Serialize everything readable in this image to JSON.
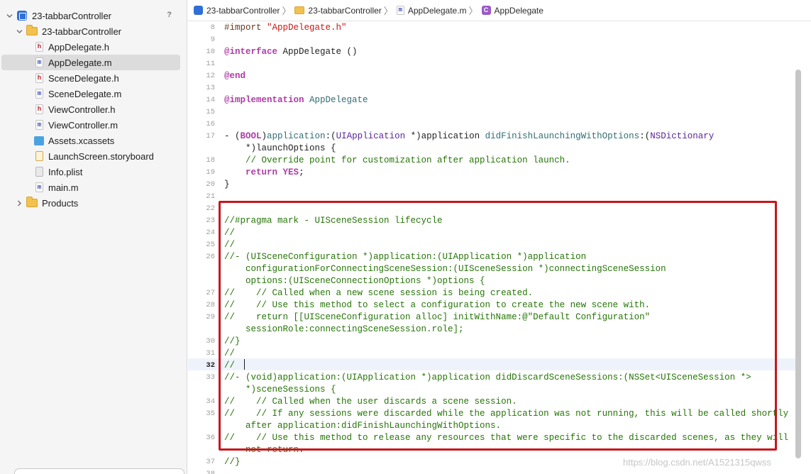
{
  "navigator": {
    "project_name": "23-tabbarController",
    "scm_badge": "?",
    "group_name": "23-tabbarController",
    "files": [
      {
        "name": "AppDelegate.h",
        "kind": "h"
      },
      {
        "name": "AppDelegate.m",
        "kind": "m",
        "selected": true
      },
      {
        "name": "SceneDelegate.h",
        "kind": "h"
      },
      {
        "name": "SceneDelegate.m",
        "kind": "m"
      },
      {
        "name": "ViewController.h",
        "kind": "h"
      },
      {
        "name": "ViewController.m",
        "kind": "m"
      },
      {
        "name": "Assets.xcassets",
        "kind": "assets"
      },
      {
        "name": "LaunchScreen.storyboard",
        "kind": "storyboard"
      },
      {
        "name": "Info.plist",
        "kind": "plist"
      },
      {
        "name": "main.m",
        "kind": "m"
      }
    ],
    "products_label": "Products"
  },
  "jumpbar": {
    "project": "23-tabbarController",
    "group": "23-tabbarController",
    "file": "AppDelegate.m",
    "symbol": "AppDelegate"
  },
  "editor": {
    "current_line": "32",
    "line_numbers": [
      "8",
      "9",
      "10",
      "11",
      "12",
      "13",
      "14",
      "15",
      "16",
      "17",
      "18",
      "19",
      "20",
      "21",
      "22",
      "23",
      "24",
      "25",
      "26",
      "27",
      "28",
      "29",
      "30",
      "31",
      "32",
      "33",
      "34",
      "35",
      "36",
      "37",
      "38"
    ],
    "code": {
      "l8a": "#import ",
      "l8b": "\"AppDelegate.h\"",
      "l10a": "@interface",
      "l10b": " AppDelegate ()",
      "l12": "@end",
      "l14a": "@implementation",
      "l14b": " AppDelegate",
      "l17a": "- (",
      "l17b": "BOOL",
      "l17c": ")",
      "l17d": "application",
      "l17e": ":(",
      "l17f": "UIApplication",
      "l17g": " *)application ",
      "l17h": "didFinishLaunchingWithOptions",
      "l17i": ":(",
      "l17j": "NSDictionary",
      "l17k": "    *)launchOptions {",
      "l18": "    // Override point for customization after application launch.",
      "l19a": "    ",
      "l19b": "return",
      "l19c": " ",
      "l19d": "YES",
      "l19e": ";",
      "l20": "}",
      "l23": "//#pragma mark - UISceneSession lifecycle",
      "l24": "//",
      "l25": "//",
      "l26a": "//- (UISceneConfiguration *)application:(UIApplication *)application",
      "l26b": "    configurationForConnectingSceneSession:(UISceneSession *)connectingSceneSession",
      "l26c": "    options:(UISceneConnectionOptions *)options {",
      "l27": "//    // Called when a new scene session is being created.",
      "l28": "//    // Use this method to select a configuration to create the new scene with.",
      "l29a": "//    return [[UISceneConfiguration alloc] initWithName:@\"Default Configuration\"",
      "l29b": "    sessionRole:connectingSceneSession.role];",
      "l30": "//}",
      "l31": "//",
      "l32": "//",
      "l33a": "//- (void)application:(UIApplication *)application didDiscardSceneSessions:(NSSet<UISceneSession *>",
      "l33b": "    *)sceneSessions {",
      "l34": "//    // Called when the user discards a scene session.",
      "l35a": "//    // If any sessions were discarded while the application was not running, this will be called shortly",
      "l35b": "    after application:didFinishLaunchingWithOptions.",
      "l36a": "//    // Use this method to release any resources that were specific to the discarded scenes, as they will",
      "l36b": "    not return.",
      "l37": "//}"
    }
  },
  "watermark": "https://blog.csdn.net/A1521315qwss",
  "colors": {
    "highlight_box": "#c8161d",
    "keyword": "#ad3da4",
    "comment": "#267507",
    "string": "#c41a16",
    "type": "#5b2699"
  }
}
